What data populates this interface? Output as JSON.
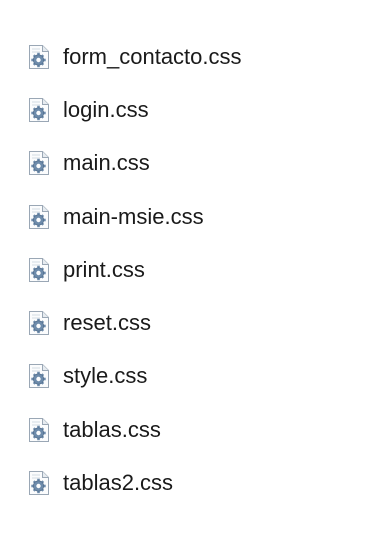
{
  "file_list": {
    "icon": "css-file-icon",
    "items": [
      {
        "label": "form_contacto.css"
      },
      {
        "label": "login.css"
      },
      {
        "label": "main.css"
      },
      {
        "label": "main-msie.css"
      },
      {
        "label": "print.css"
      },
      {
        "label": "reset.css"
      },
      {
        "label": "style.css"
      },
      {
        "label": "tablas.css"
      },
      {
        "label": "tablas2.css"
      }
    ]
  },
  "colors": {
    "text": "#1a1a1a",
    "gear": "#5f7f9e",
    "page_outline": "#9aa7b5"
  }
}
